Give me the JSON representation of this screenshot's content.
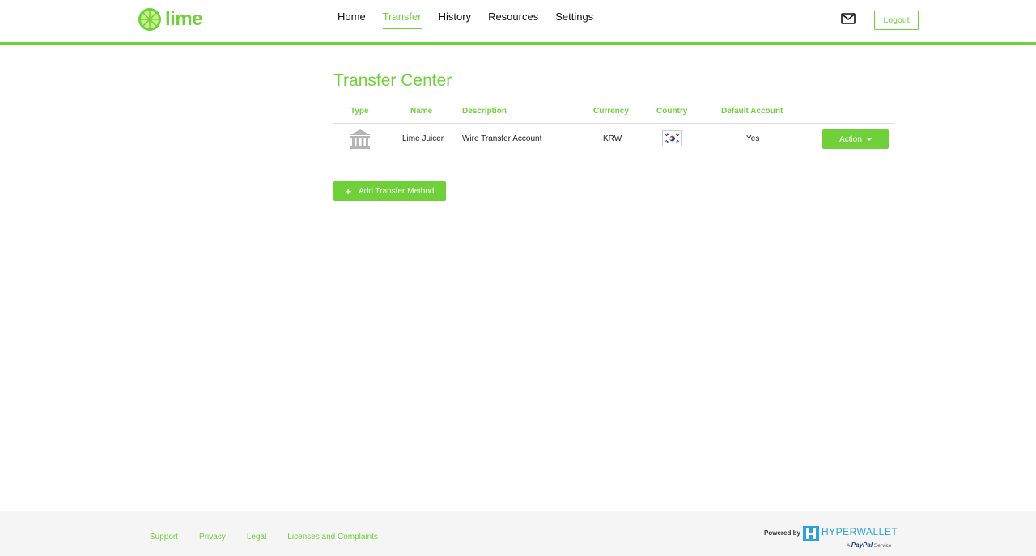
{
  "app": {
    "logo_text": "lime",
    "brand_color": "#6fd03a"
  },
  "nav": {
    "items": [
      {
        "label": "Home"
      },
      {
        "label": "Transfer"
      },
      {
        "label": "History"
      },
      {
        "label": "Resources"
      },
      {
        "label": "Settings"
      }
    ],
    "active": "Transfer"
  },
  "header": {
    "mail_icon": "envelope-icon",
    "logout_label": "Logout"
  },
  "main": {
    "title": "Transfer Center",
    "columns": [
      "Type",
      "Name",
      "Description",
      "Currency",
      "Country",
      "Default Account"
    ],
    "rows": [
      {
        "type_icon": "bank-icon",
        "name": "Lime Juicer",
        "description": "Wire Transfer Account",
        "currency": "KRW",
        "country_flag": "south-korea-flag",
        "default_account": "Yes",
        "action_label": "Action"
      }
    ],
    "add_button_label": "Add Transfer Method"
  },
  "footer": {
    "links": [
      "Support",
      "Privacy",
      "Legal",
      "Licenses and Complaints"
    ],
    "powered_by": "Powered by",
    "provider": "HYPERWALLET",
    "paypal_prefix": "A",
    "paypal_brand": "PayPal",
    "paypal_suffix": "Service"
  }
}
